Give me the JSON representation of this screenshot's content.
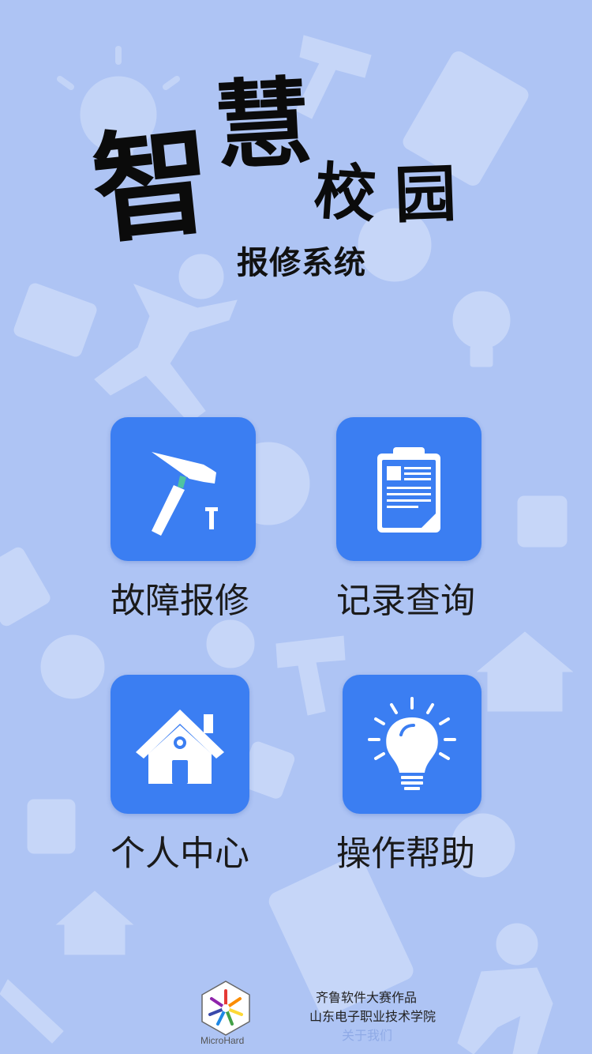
{
  "title": {
    "chars": [
      "智",
      "慧",
      "校",
      "园"
    ],
    "subtitle": "报修系统"
  },
  "menu": [
    {
      "id": "repair",
      "label": "故障报修",
      "icon": "hammer-nail-icon"
    },
    {
      "id": "records",
      "label": "记录查询",
      "icon": "clipboard-icon"
    },
    {
      "id": "profile",
      "label": "个人中心",
      "icon": "house-icon"
    },
    {
      "id": "help",
      "label": "操作帮助",
      "icon": "lightbulb-icon"
    }
  ],
  "footer": {
    "logo_text": "MicroHard",
    "line1": "齐鲁软件大赛作品",
    "line2": "山东电子职业技术学院",
    "about_link": "关于我们"
  },
  "colors": {
    "background": "#aec4f4",
    "tile": "#3b7ef2",
    "icon": "#ffffff",
    "decoration": "#c6d6f8",
    "about_link": "#8faae6"
  }
}
